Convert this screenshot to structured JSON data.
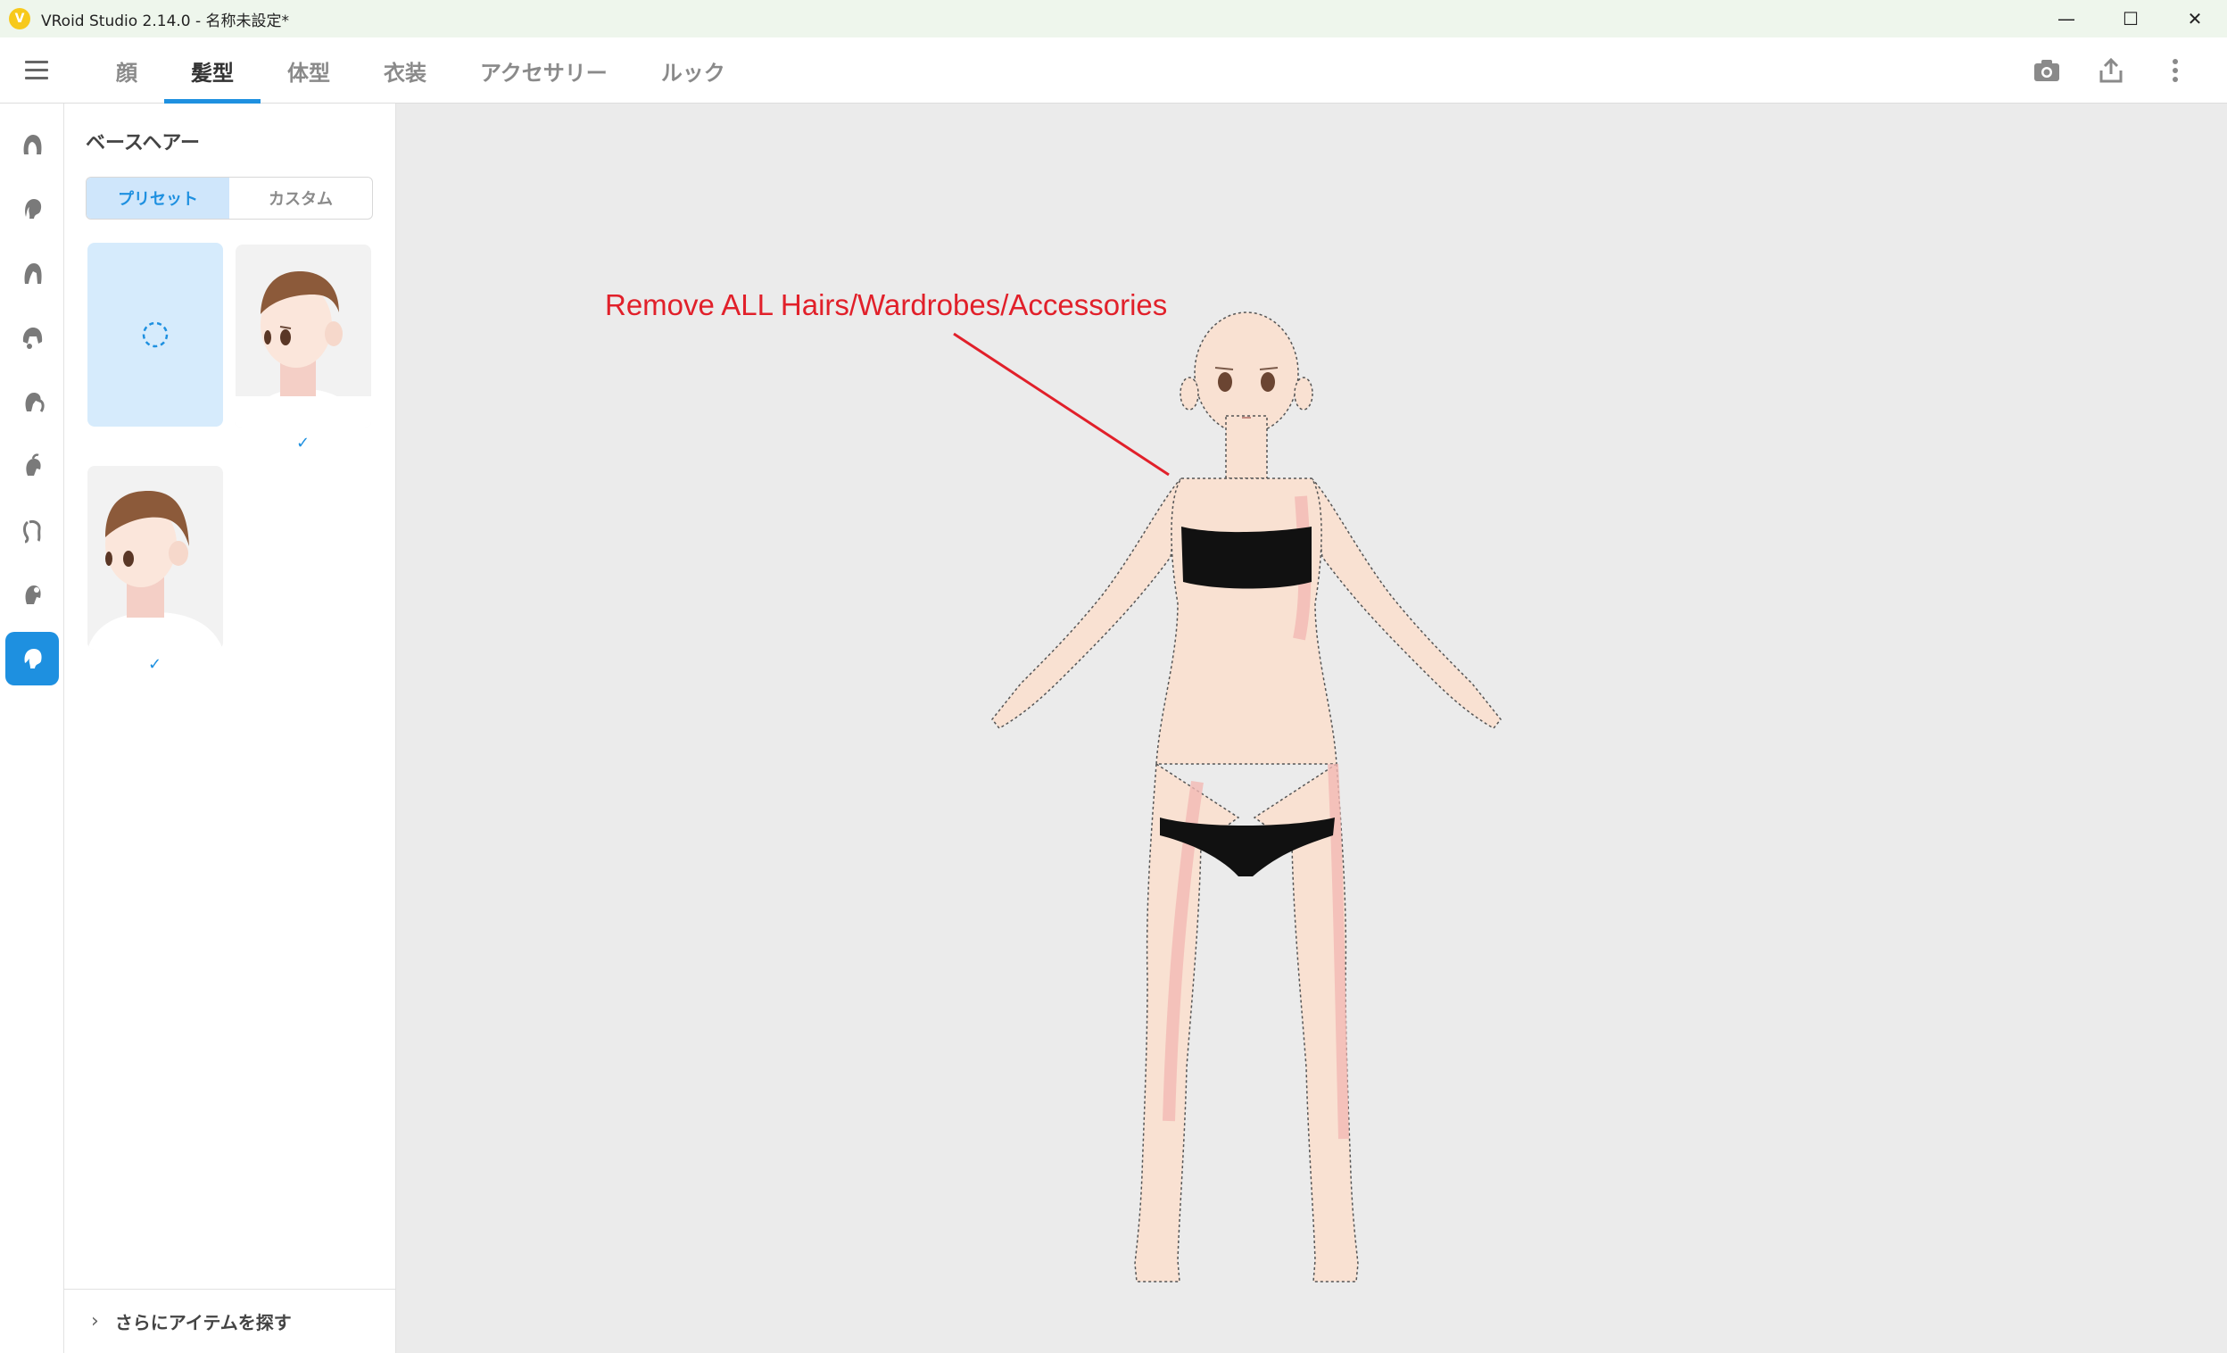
{
  "window": {
    "title": "VRoid Studio 2.14.0 - 名称未設定*",
    "logo": "V",
    "controls": {
      "minimize": "—",
      "maximize": "☐",
      "close": "✕"
    }
  },
  "nav": {
    "tabs": [
      {
        "label": "顔",
        "active": false
      },
      {
        "label": "髪型",
        "active": true
      },
      {
        "label": "体型",
        "active": false
      },
      {
        "label": "衣装",
        "active": false
      },
      {
        "label": "アクセサリー",
        "active": false
      },
      {
        "label": "ルック",
        "active": false
      }
    ],
    "actions": [
      "camera-icon",
      "share-icon",
      "more-vertical-icon"
    ]
  },
  "rail": {
    "items": [
      "front-hair-icon",
      "back-hair-icon",
      "side-hair-icon",
      "hair-bun-icon",
      "ponytail-icon",
      "ahoge-icon",
      "braid-icon",
      "extra-hair-icon",
      "base-hair-icon"
    ],
    "active_index": 8
  },
  "panel": {
    "title": "ベースヘアー",
    "segments": {
      "preset": "プリセット",
      "custom": "カスタム"
    },
    "more_label": "さらにアイテムを探す",
    "thumbnails": [
      {
        "type": "new",
        "selected": true
      },
      {
        "type": "hair-preset",
        "check": "✓"
      },
      {
        "type": "hair-preset",
        "check": "✓"
      }
    ]
  },
  "viewport": {
    "annotation": "Remove ALL Hairs/Wardrobes/Accessories",
    "annotation_color": "#e1202a"
  },
  "colors": {
    "accent": "#1e90e0",
    "skin": "#f9e1d2",
    "underwear": "#111111"
  }
}
